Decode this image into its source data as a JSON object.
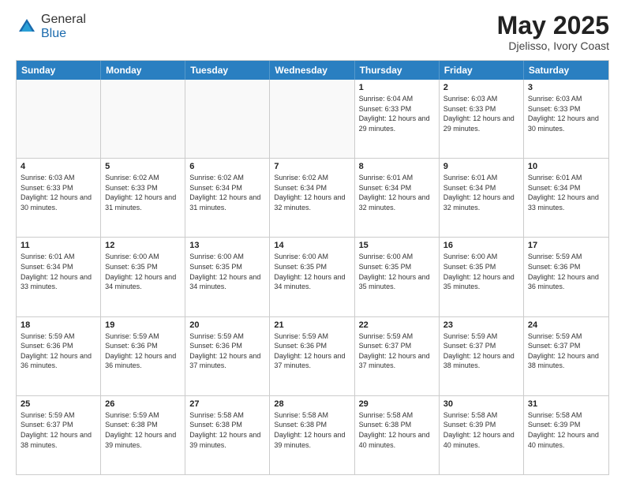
{
  "header": {
    "logo": {
      "general": "General",
      "blue": "Blue"
    },
    "title": "May 2025",
    "location": "Djelisso, Ivory Coast"
  },
  "calendar": {
    "weekdays": [
      "Sunday",
      "Monday",
      "Tuesday",
      "Wednesday",
      "Thursday",
      "Friday",
      "Saturday"
    ],
    "rows": [
      [
        {
          "day": "",
          "empty": true
        },
        {
          "day": "",
          "empty": true
        },
        {
          "day": "",
          "empty": true
        },
        {
          "day": "",
          "empty": true
        },
        {
          "day": "1",
          "sunrise": "6:04 AM",
          "sunset": "6:33 PM",
          "daylight": "12 hours and 29 minutes."
        },
        {
          "day": "2",
          "sunrise": "6:03 AM",
          "sunset": "6:33 PM",
          "daylight": "12 hours and 29 minutes."
        },
        {
          "day": "3",
          "sunrise": "6:03 AM",
          "sunset": "6:33 PM",
          "daylight": "12 hours and 30 minutes."
        }
      ],
      [
        {
          "day": "4",
          "sunrise": "6:03 AM",
          "sunset": "6:33 PM",
          "daylight": "12 hours and 30 minutes."
        },
        {
          "day": "5",
          "sunrise": "6:02 AM",
          "sunset": "6:33 PM",
          "daylight": "12 hours and 31 minutes."
        },
        {
          "day": "6",
          "sunrise": "6:02 AM",
          "sunset": "6:34 PM",
          "daylight": "12 hours and 31 minutes."
        },
        {
          "day": "7",
          "sunrise": "6:02 AM",
          "sunset": "6:34 PM",
          "daylight": "12 hours and 32 minutes."
        },
        {
          "day": "8",
          "sunrise": "6:01 AM",
          "sunset": "6:34 PM",
          "daylight": "12 hours and 32 minutes."
        },
        {
          "day": "9",
          "sunrise": "6:01 AM",
          "sunset": "6:34 PM",
          "daylight": "12 hours and 32 minutes."
        },
        {
          "day": "10",
          "sunrise": "6:01 AM",
          "sunset": "6:34 PM",
          "daylight": "12 hours and 33 minutes."
        }
      ],
      [
        {
          "day": "11",
          "sunrise": "6:01 AM",
          "sunset": "6:34 PM",
          "daylight": "12 hours and 33 minutes."
        },
        {
          "day": "12",
          "sunrise": "6:00 AM",
          "sunset": "6:35 PM",
          "daylight": "12 hours and 34 minutes."
        },
        {
          "day": "13",
          "sunrise": "6:00 AM",
          "sunset": "6:35 PM",
          "daylight": "12 hours and 34 minutes."
        },
        {
          "day": "14",
          "sunrise": "6:00 AM",
          "sunset": "6:35 PM",
          "daylight": "12 hours and 34 minutes."
        },
        {
          "day": "15",
          "sunrise": "6:00 AM",
          "sunset": "6:35 PM",
          "daylight": "12 hours and 35 minutes."
        },
        {
          "day": "16",
          "sunrise": "6:00 AM",
          "sunset": "6:35 PM",
          "daylight": "12 hours and 35 minutes."
        },
        {
          "day": "17",
          "sunrise": "5:59 AM",
          "sunset": "6:36 PM",
          "daylight": "12 hours and 36 minutes."
        }
      ],
      [
        {
          "day": "18",
          "sunrise": "5:59 AM",
          "sunset": "6:36 PM",
          "daylight": "12 hours and 36 minutes."
        },
        {
          "day": "19",
          "sunrise": "5:59 AM",
          "sunset": "6:36 PM",
          "daylight": "12 hours and 36 minutes."
        },
        {
          "day": "20",
          "sunrise": "5:59 AM",
          "sunset": "6:36 PM",
          "daylight": "12 hours and 37 minutes."
        },
        {
          "day": "21",
          "sunrise": "5:59 AM",
          "sunset": "6:36 PM",
          "daylight": "12 hours and 37 minutes."
        },
        {
          "day": "22",
          "sunrise": "5:59 AM",
          "sunset": "6:37 PM",
          "daylight": "12 hours and 37 minutes."
        },
        {
          "day": "23",
          "sunrise": "5:59 AM",
          "sunset": "6:37 PM",
          "daylight": "12 hours and 38 minutes."
        },
        {
          "day": "24",
          "sunrise": "5:59 AM",
          "sunset": "6:37 PM",
          "daylight": "12 hours and 38 minutes."
        }
      ],
      [
        {
          "day": "25",
          "sunrise": "5:59 AM",
          "sunset": "6:37 PM",
          "daylight": "12 hours and 38 minutes."
        },
        {
          "day": "26",
          "sunrise": "5:59 AM",
          "sunset": "6:38 PM",
          "daylight": "12 hours and 39 minutes."
        },
        {
          "day": "27",
          "sunrise": "5:58 AM",
          "sunset": "6:38 PM",
          "daylight": "12 hours and 39 minutes."
        },
        {
          "day": "28",
          "sunrise": "5:58 AM",
          "sunset": "6:38 PM",
          "daylight": "12 hours and 39 minutes."
        },
        {
          "day": "29",
          "sunrise": "5:58 AM",
          "sunset": "6:38 PM",
          "daylight": "12 hours and 40 minutes."
        },
        {
          "day": "30",
          "sunrise": "5:58 AM",
          "sunset": "6:39 PM",
          "daylight": "12 hours and 40 minutes."
        },
        {
          "day": "31",
          "sunrise": "5:58 AM",
          "sunset": "6:39 PM",
          "daylight": "12 hours and 40 minutes."
        }
      ]
    ]
  }
}
